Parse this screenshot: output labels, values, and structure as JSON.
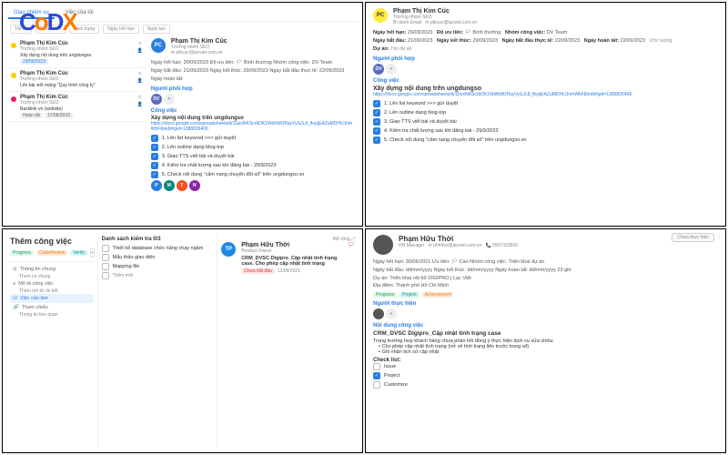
{
  "panel1": {
    "tabs": [
      "Giao nhiệm vụ",
      "Việc của tôi"
    ],
    "filters": [
      "Tất cả",
      "Độ ưu tiên",
      "Tình trạng",
      "Ngày hết hạn",
      "Ngày tạo"
    ],
    "items": [
      {
        "title": "Phạm Thị Kim Cúc",
        "role": "Trưởng nhóm SEO",
        "task": "Xây dựng nội dung trên ungdungso",
        "date": "29/09/2023",
        "dot": "y"
      },
      {
        "title": "Phạm Thị Kim Cúc",
        "role": "Trưởng nhóm SEO",
        "task": "Lên bài viết mảng \"Quy trình công ty\"",
        "date": "",
        "dot": "y"
      },
      {
        "title": "Phạm Thị Kim Cúc",
        "role": "Trưởng nhóm SEO",
        "task": "Backlink vn (website)",
        "badge": "Hoàn tất",
        "date": "17/08/2023",
        "dot": "p"
      }
    ],
    "detail": {
      "name": "Phạm Thị Kim Cúc",
      "role": "Trưởng nhóm SEO",
      "email": "ptkcuc@lacviet.com.vn",
      "meta": "Ngày hết hạn: 29/09/2023   Độ ưu tiên: 🏳 Bình thường   Nhóm công việc: DV Team",
      "meta2": "Ngày bắt đầu: 21/09/2023   Ngày kết thúc: 29/09/2023   Ngày bắt đầu thực tế: 22/09/2023   Ngày hoàn tất:",
      "section1": "Người phối hợp",
      "section2": "Công việc",
      "taskTitle": "Xây dựng nội dung trên ungdungso",
      "link": "https://docs.google.com/spreadsheets/d/11wvNKScrbDK1WdhWDPpyVySJL8_fkyqEAZuMDHUJnmWhF8/edit#gid=1388826406",
      "checks": [
        "1. Lên list keyword >>> gửi duyệt",
        "2. Lên outline dạng blog-top",
        "3. Giao TTS viết bài và duyệt bài",
        "4. Kiểm tra chất lượng sau khi đăng bài - 29/9/2023",
        "5. Check nội dung \"cẩm nang chuyển đổi số\" trên ungdungso.vn"
      ]
    }
  },
  "panel2": {
    "name": "Phạm Thị Kim Cúc",
    "role": "Trưởng nhóm SEO",
    "emailLabel": "Bí danh Email",
    "email": "ptkcuc@lacviet.com.vn",
    "row1": {
      "l1": "Ngày hết hạn:",
      "v1": "29/09/2023",
      "l2": "Độ ưu tiên:",
      "v2": "🏳 Bình thường",
      "l3": "Nhóm công việc:",
      "v3": "DV Team"
    },
    "row2": {
      "l1": "Ngày bắt đầu:",
      "v1": "21/09/2023",
      "l2": "Ngày kết thúc:",
      "v2": "29/09/2023",
      "l3": "Ngày bắt đầu thực tế:",
      "v3": "22/09/2023",
      "l4": "Ngày hoàn tất:",
      "v4": "22/09/2023",
      "l5": "Ước lượng"
    },
    "row3": {
      "l1": "Dự án:",
      "v1": "Tên dự án"
    },
    "section1": "Người phối hợp",
    "section2": "Công việc",
    "taskTitle": "Xây dựng nội dung trên ungdungso",
    "link": "https://docs.google.com/spreadsheets/d/11wvNKScrbDK1WdhWDPpyVySJL8_fkyqEAZuMDHUJnmWhF8/edit#gid=1388826406",
    "checks": [
      "1. Lên list keyword >>> gửi duyệt",
      "2. Lên outline dạng blog-top",
      "3. Giao TTS viết bài và duyệt bài",
      "4. Kiểm tra chất lượng sau khi đăng bài - 29/9/2023",
      "5. Check nội dung \"cẩm nang chuyển đổi số\" trên ungdungso.vn"
    ]
  },
  "panel3": {
    "title": "Thêm công việc",
    "tags": [
      "Progress",
      "CodeReview",
      "Verify"
    ],
    "nav": [
      {
        "label": "Thông tin chung",
        "sub": "Them cu chung"
      },
      {
        "label": "Mô tả công việc",
        "sub": "Thêm mô tả chi tiết"
      },
      {
        "label": "Việc cần làm",
        "sub": "",
        "active": true
      },
      {
        "label": "Tham chiếu",
        "sub": "Thong tin lien quan"
      }
    ],
    "checklistTitle": "Danh sách kiểm tra  0/3",
    "checks": [
      "Thiết kế database chức năng chạy ngầm",
      "Mẫu thảo giao diện",
      "Mapping file",
      "Thêm mới"
    ],
    "more": "Mở rộng",
    "author": {
      "name": "Phạm Hữu Thời",
      "role": "Product Owner",
      "taskTitle": "CRM_DVSC Digipro_Cập nhật tình trạng case. Cho phép cập nhật tình trạng",
      "badge": "Chưa bắt đầu",
      "date": "12/09/2021"
    }
  },
  "panel4": {
    "name": "Phạm Hữu Thời",
    "role": "HR Manager",
    "email": "phhthoi@lacviet.com.vn",
    "phone": "0907323569",
    "row1": "Ngày hết hạn: 30/06/2021    Ưu tiên: 🏳 Cao    Nhóm công việc: Triển khai dự án",
    "row2": "Ngày bắt đầu: dd/mm/yyyy    Ngày kết thúc: dd/mm/yyyy    Ngày hoàn tất: dd/mm/yyyy 23 giờ",
    "row3": "Dự án: Triển khai nội bộ DIGIPRO | Lạc Việt",
    "row4": "Địa điểm: Thành phố Hồ Chí Minh",
    "tags": [
      "Progress",
      "Project",
      "Achievement"
    ],
    "section1": "Người thực hiện",
    "section2": "Nội dung công việc",
    "contentTitle": "CRM_DVSC Digipro_Cập nhật tình trạng case",
    "contentBody": "Trong trường hợp khách hàng chưa phản hồi đồng ý thực hiện dịch vụ sửa chữa:",
    "bullets": [
      "Cho phép cập nhật tình trạng (trở về tình trạng liên trước trong wf)",
      "Ghi nhận lịch sử cập nhật"
    ],
    "checklistLabel": "Check list:",
    "checks": [
      {
        "t": "Issue",
        "c": false
      },
      {
        "t": "Project",
        "c": true
      },
      {
        "t": "Customize",
        "c": false
      }
    ],
    "btn": "Chưa thực hiện"
  }
}
